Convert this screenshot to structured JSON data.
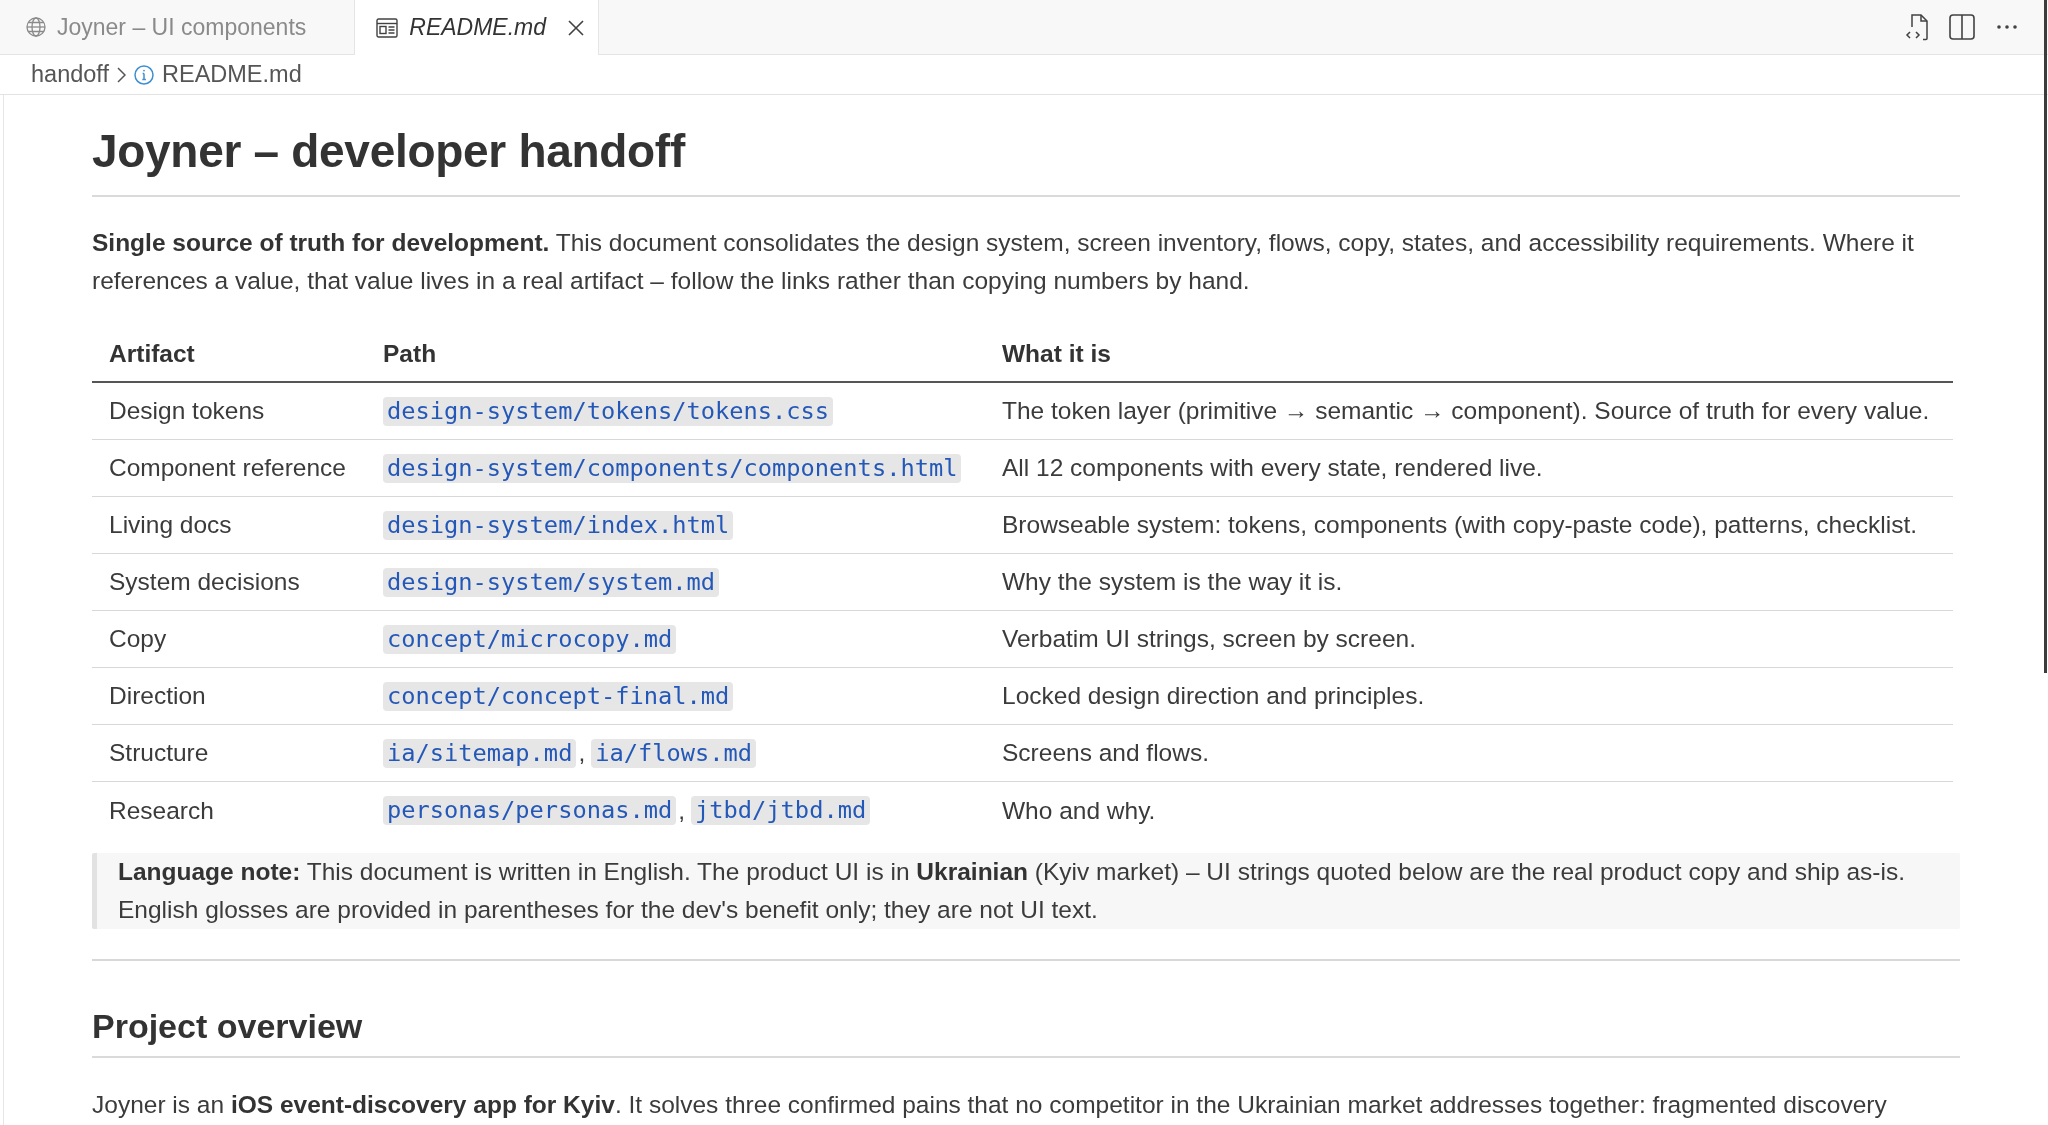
{
  "tabs": [
    {
      "label": "Joyner – UI components",
      "kind": "webview",
      "selected": false
    },
    {
      "label": "README.md",
      "kind": "preview",
      "selected": true
    }
  ],
  "breadcrumbs": [
    "handoff",
    "README.md"
  ],
  "document": {
    "title": "Joyner – developer handoff",
    "intro": "**Single source of truth for development.** This document consolidates the design system, screen inventory, flows, copy, states, and accessibility requirements. Where it references a value, that value lives in a real artifact – follow the links rather than copying numbers by hand.",
    "table": {
      "columns": [
        "Artifact",
        "Path",
        "What it is"
      ],
      "rows": [
        {
          "artifact": "Design tokens",
          "path": [
            {
              "kind": "link",
              "text": "design-system/tokens/tokens.css"
            }
          ],
          "description": "The token layer (primitive → semantic → component). Source of truth for every value."
        },
        {
          "artifact": "Component reference",
          "path": [
            {
              "kind": "link",
              "text": "design-system/components/components.html"
            }
          ],
          "description": "All 12 components with every state, rendered live."
        },
        {
          "artifact": "Living docs",
          "path": [
            {
              "kind": "link",
              "text": "design-system/index.html"
            }
          ],
          "description": "Browseable system: tokens, components (with copy-paste code), patterns, checklist."
        },
        {
          "artifact": "System decisions",
          "path": [
            {
              "kind": "link",
              "text": "design-system/system.md"
            }
          ],
          "description": "Why the system is the way it is."
        },
        {
          "artifact": "Copy",
          "path": [
            {
              "kind": "link",
              "text": "concept/microcopy.md"
            }
          ],
          "description": "Verbatim UI strings, screen by screen."
        },
        {
          "artifact": "Direction",
          "path": [
            {
              "kind": "link",
              "text": "concept/concept-final.md"
            }
          ],
          "description": "Locked design direction and principles."
        },
        {
          "artifact": "Structure",
          "path": [
            {
              "kind": "link",
              "text": "ia/sitemap.md"
            },
            {
              "kind": "text",
              "text": ","
            },
            {
              "kind": "link",
              "text": "ia/flows.md"
            }
          ],
          "description": "Screens and flows."
        },
        {
          "artifact": "Research",
          "path": [
            {
              "kind": "link",
              "text": "personas/personas.md"
            },
            {
              "kind": "text",
              "text": ","
            },
            {
              "kind": "link",
              "text": "jtbd/jtbd.md"
            }
          ],
          "description": "Who and why."
        }
      ]
    },
    "note": "**Language note:** This document is written in English. The product UI is in **Ukrainian** (Kyiv market) – UI strings quoted below are the real product copy and ship as-is. English glosses are provided in parentheses for the dev's benefit only; they are not UI text.",
    "sections": [
      {
        "heading": "Project overview",
        "paragraph": "Joyner is an **iOS event-discovery app for Kyiv**. It solves three confirmed pains that no competitor in the Ukrainian market addresses together: fragmented discovery"
      }
    ]
  }
}
